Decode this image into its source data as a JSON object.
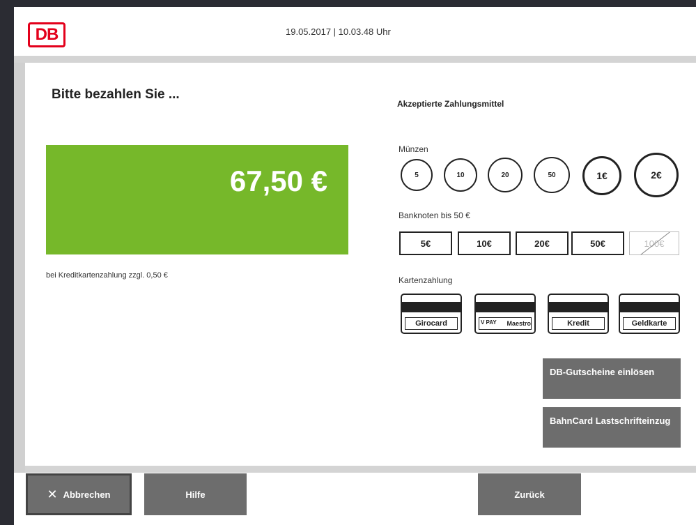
{
  "header": {
    "logo": "DB",
    "datetime": "19.05.2017 | 10.03.48 Uhr"
  },
  "payment": {
    "title": "Bitte bezahlen Sie ...",
    "amount": "67,50 €",
    "credit_note": "bei Kreditkartenzahlung zzgl. 0,50 €"
  },
  "accepted": {
    "title": "Akzeptierte Zahlungsmittel",
    "coins_label": "Münzen",
    "coins": [
      "5",
      "10",
      "20",
      "50",
      "1€",
      "2€"
    ],
    "notes_label": "Banknoten bis 50 €",
    "notes": [
      "5€",
      "10€",
      "20€",
      "50€",
      "100€"
    ],
    "cards_label": "Kartenzahlung",
    "cards": [
      "Girocard",
      "Maestro",
      "Kredit",
      "Geldkarte"
    ],
    "vpay_text": "V PAY"
  },
  "side_buttons": {
    "voucher": "DB-Gutscheine einlösen",
    "bahncard": "BahnCard Lastschrifteinzug"
  },
  "bottom": {
    "cancel": "Abbrechen",
    "help": "Hilfe",
    "back": "Zurück"
  },
  "colors": {
    "amount_bg": "#76b82a",
    "button_bg": "#6d6d6d",
    "db_red": "#e3001b"
  }
}
